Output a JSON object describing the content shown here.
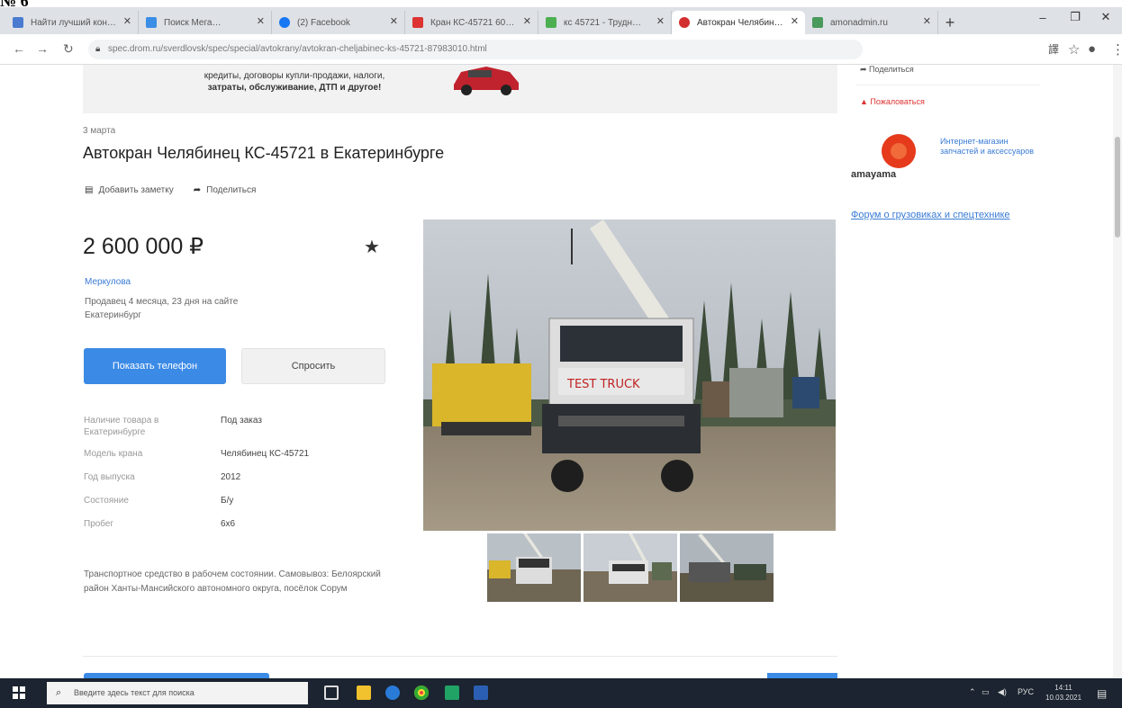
{
  "doc_heading": "№ 6",
  "browser": {
    "tabs": [
      {
        "label": "Найти лучший кон…",
        "color": "#4a7bd0",
        "active": false
      },
      {
        "label": "Поиск Мега…",
        "color": "#3a8ee6",
        "active": false
      },
      {
        "label": "(2) Facebook",
        "color": "#1877f2",
        "active": false
      },
      {
        "label": "Кран КС-45721 60…",
        "color": "#d33",
        "active": false
      },
      {
        "label": "кс 45721 - Трудн…",
        "color": "#4caf50",
        "active": false
      },
      {
        "label": "Автокран Челябин…",
        "color": "#d32f2f",
        "active": true
      },
      {
        "label": "amonadmin.ru",
        "color": "#4a9a5c",
        "active": false
      }
    ],
    "new_tab": "+",
    "url": "spec.drom.ru/sverdlovsk/spec/special/avtokrany/avtokran-cheljabinec-ks-45721-87983010.html",
    "win_minimize": "–",
    "win_maximize": "❐",
    "win_close": "✕"
  },
  "banner": {
    "line1": "кредиты, договоры купли-продажи, налоги,",
    "line2": "затраты, обслуживание, ДТП и другое!"
  },
  "listing": {
    "date": "3 марта",
    "title": "Автокран Челябинец КС-45721 в Екатеринбурге",
    "add_note": "Добавить заметку",
    "share": "Поделиться",
    "price": "2 600 000 ₽",
    "seller_name": "Меркулова",
    "seller_since": "Продавец 4 месяца, 23 дня на сайте",
    "seller_city": "Екатеринбург",
    "show_phone": "Показать телефон",
    "ask": "Спросить",
    "params": [
      {
        "key": "Наличие товара в Екатеринбурге",
        "value": "Под заказ"
      },
      {
        "key": "Модель крана",
        "value": "Челябинец КС-45721"
      },
      {
        "key": "Год выпуска",
        "value": "2012"
      },
      {
        "key": "Состояние",
        "value": "Б/у"
      },
      {
        "key": "Пробег",
        "value": "6х6"
      }
    ],
    "description": "Транспортное средство в рабочем состоянии. Самовывоз: Белоярский район Ханты-Мансийского автономного округа, посёлок Сорум"
  },
  "sidebar": {
    "share": "Поделиться",
    "complain": "Пожаловаться",
    "ad_brand": "amayama",
    "ad_text": "Интернет-магазин запчастей и аксессуаров",
    "forum_link": "Форум о грузовиках и спецтехнике"
  },
  "taskbar": {
    "search_placeholder": "Введите здесь текст для поиска",
    "lang": "РУС",
    "time": "14:11",
    "date": "10.03.2021"
  }
}
